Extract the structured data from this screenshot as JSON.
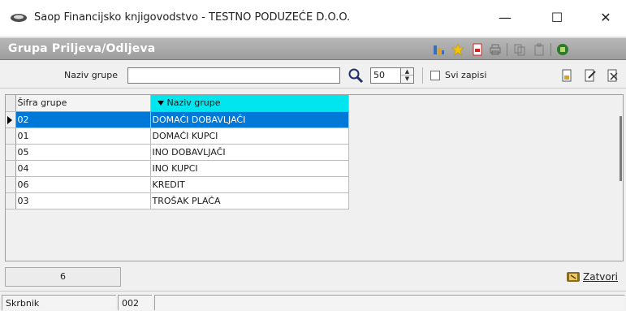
{
  "window": {
    "title": "Saop Financijsko knjigovodstvo - TESTNO PODUZEĆE D.O.O.",
    "minimize_glyph": "—",
    "maximize_glyph": "☐",
    "close_glyph": "✕"
  },
  "panel": {
    "title": "Grupa Priljeva/Odljeva"
  },
  "filter": {
    "label": "Naziv grupe",
    "value": "",
    "count": "50",
    "all_records_label": "Svi zapisi",
    "all_records_checked": false
  },
  "grid": {
    "columns": [
      "Šifra grupe",
      "Naziv grupe"
    ],
    "sorted_column": "Naziv grupe",
    "rows": [
      {
        "code": "02",
        "name": "DOMAĆI DOBAVLJAČI"
      },
      {
        "code": "01",
        "name": "DOMAĆI KUPCI"
      },
      {
        "code": "05",
        "name": "INO DOBAVLJAČI"
      },
      {
        "code": "04",
        "name": "INO KUPCI"
      },
      {
        "code": "06",
        "name": "KREDIT"
      },
      {
        "code": "03",
        "name": "TROŠAK PLAĆA"
      }
    ],
    "selected_row": 0
  },
  "footer": {
    "record_count": "6",
    "close_label": "Zatvori"
  },
  "status": {
    "user": "Skrbnik",
    "code": "002",
    "message": ""
  },
  "colors": {
    "header_column_active": "#00e5ee",
    "selection": "#0078d7",
    "panel_header": "#a8a8a8"
  }
}
